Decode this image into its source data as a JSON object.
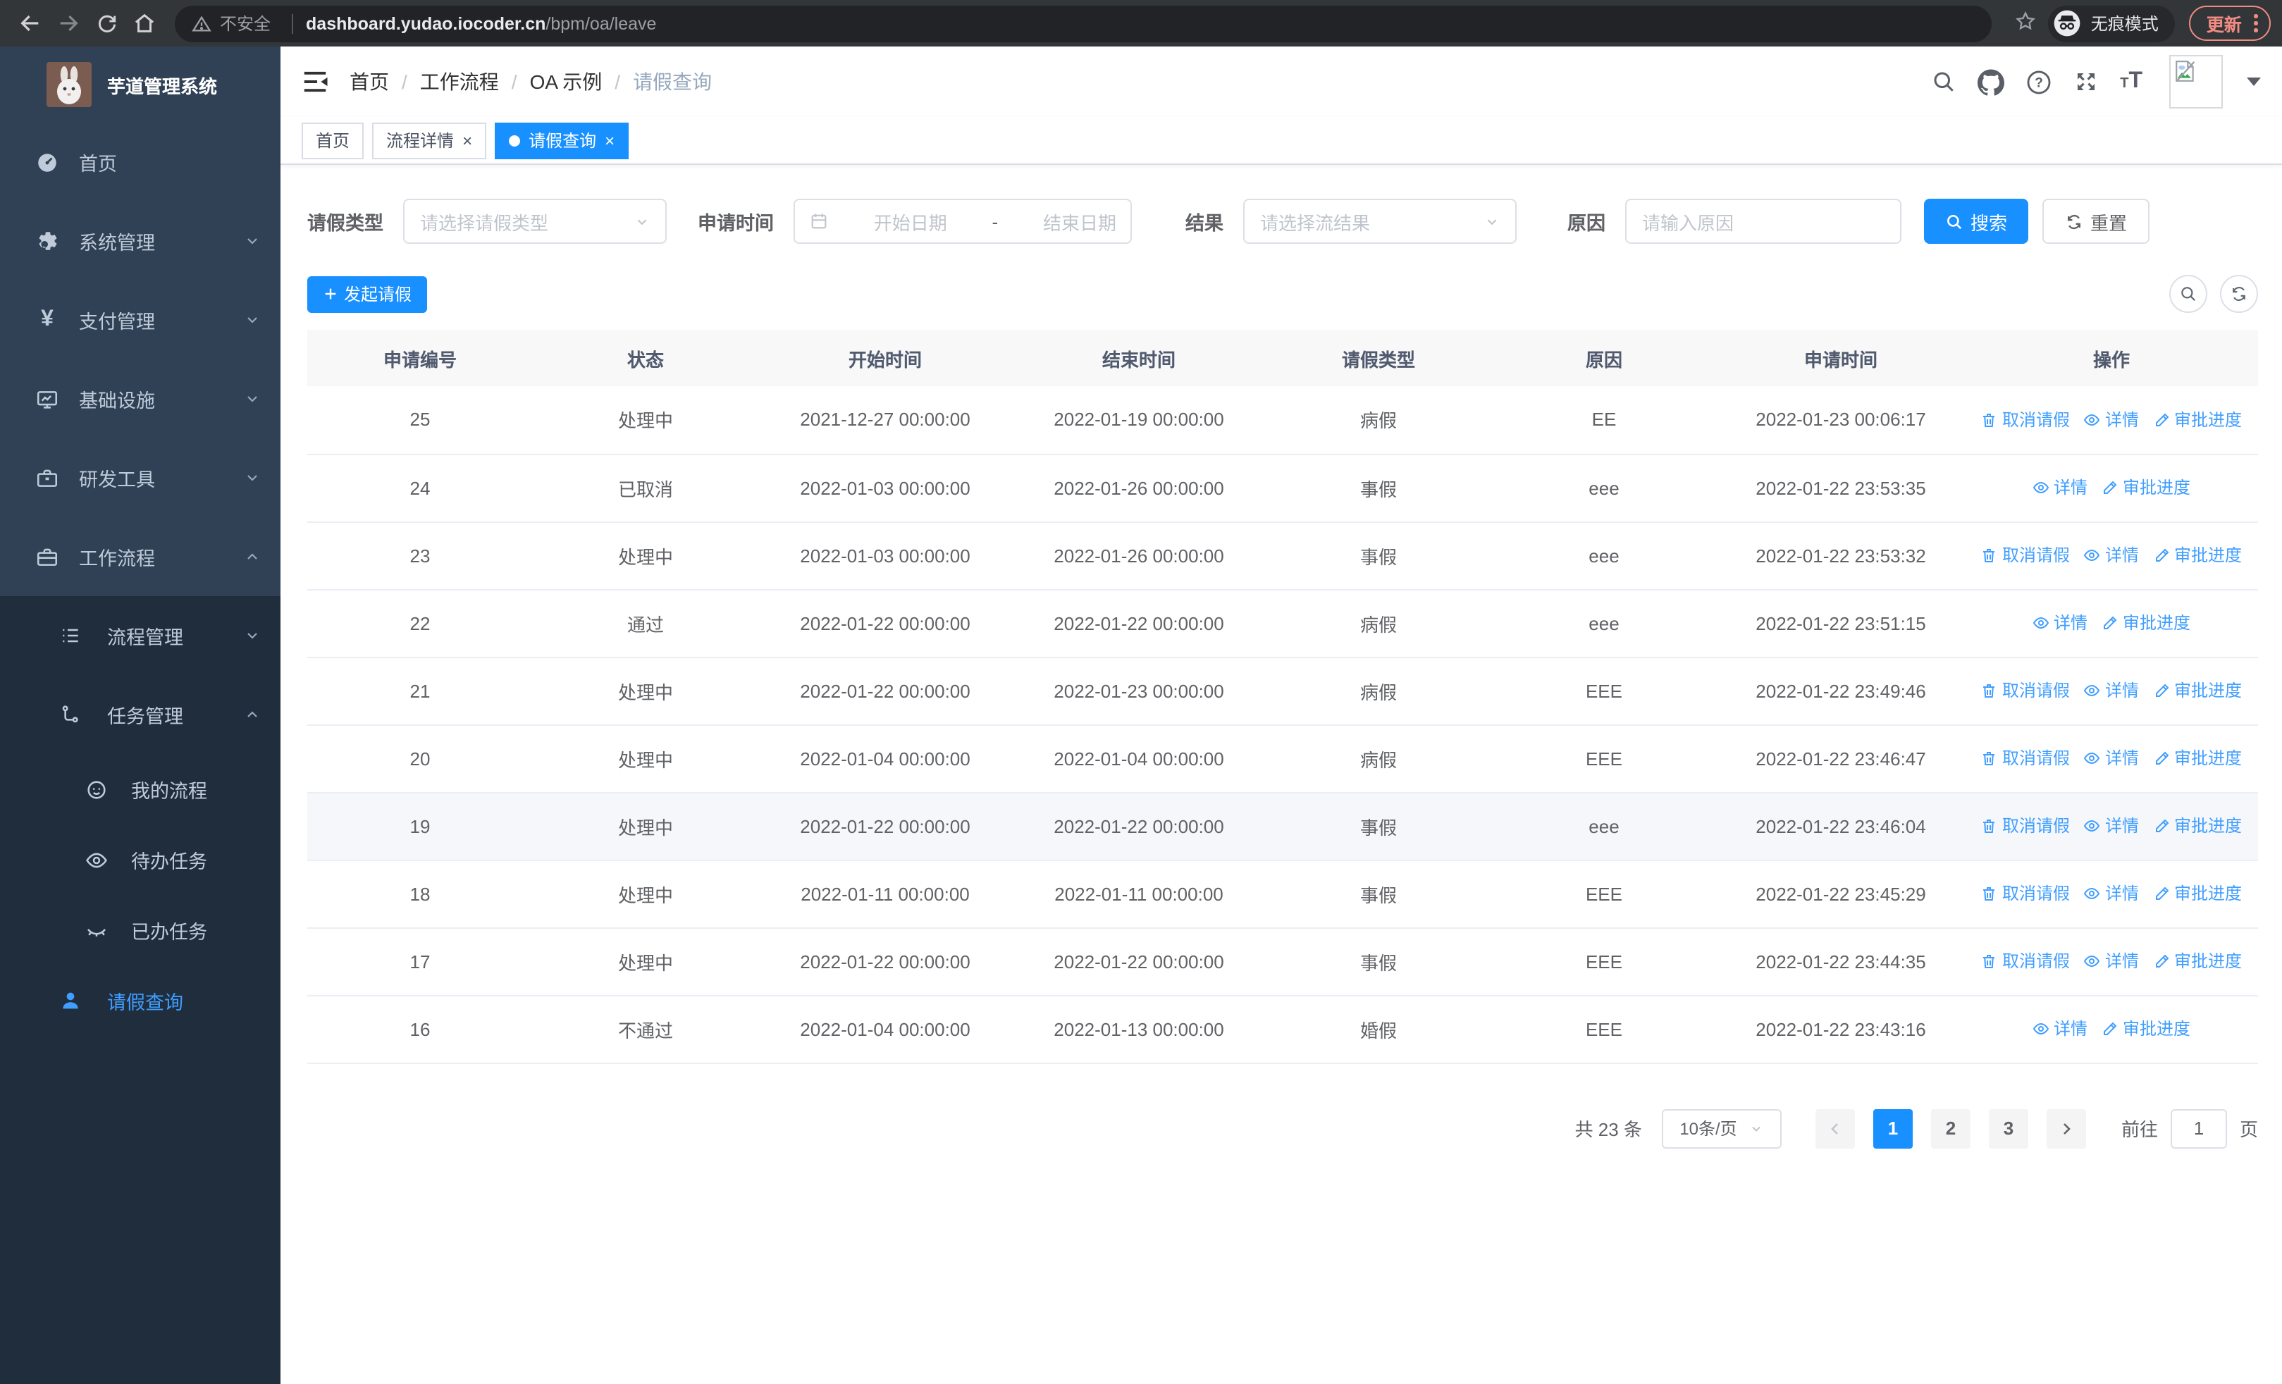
{
  "browser": {
    "security_label": "不安全",
    "url_host": "dashboard.yudao.iocoder.cn",
    "url_path": "/bpm/oa/leave",
    "incognito_label": "无痕模式",
    "update_label": "更新"
  },
  "sidebar": {
    "title": "芋道管理系统",
    "home": "首页",
    "system": "系统管理",
    "payment": "支付管理",
    "infra": "基础设施",
    "devtools": "研发工具",
    "workflow": "工作流程",
    "process_mgmt": "流程管理",
    "task_mgmt": "任务管理",
    "my_process": "我的流程",
    "todo_tasks": "待办任务",
    "done_tasks": "已办任务",
    "leave_query": "请假查询"
  },
  "navbar": {
    "breadcrumb": [
      "首页",
      "工作流程",
      "OA 示例",
      "请假查询"
    ]
  },
  "tabs": {
    "home": "首页",
    "process_detail": "流程详情",
    "leave_query": "请假查询"
  },
  "filters": {
    "leave_type_label": "请假类型",
    "leave_type_placeholder": "请选择请假类型",
    "apply_time_label": "申请时间",
    "start_placeholder": "开始日期",
    "separator": "-",
    "end_placeholder": "结束日期",
    "result_label": "结果",
    "result_placeholder": "请选择流结果",
    "reason_label": "原因",
    "reason_placeholder": "请输入原因",
    "search_label": "搜索",
    "reset_label": "重置"
  },
  "toolbar": {
    "create_label": "发起请假"
  },
  "table": {
    "columns": [
      "申请编号",
      "状态",
      "开始时间",
      "结束时间",
      "请假类型",
      "原因",
      "申请时间",
      "操作"
    ],
    "action_labels": {
      "cancel": "取消请假",
      "detail": "详情",
      "progress": "审批进度"
    },
    "rows": [
      {
        "id": "25",
        "status": "处理中",
        "start": "2021-12-27 00:00:00",
        "end": "2022-01-19 00:00:00",
        "type": "病假",
        "reason": "EE",
        "applied": "2022-01-23 00:06:17",
        "actions": [
          "cancel",
          "detail",
          "progress"
        ],
        "highlight": false
      },
      {
        "id": "24",
        "status": "已取消",
        "start": "2022-01-03 00:00:00",
        "end": "2022-01-26 00:00:00",
        "type": "事假",
        "reason": "eee",
        "applied": "2022-01-22 23:53:35",
        "actions": [
          "detail",
          "progress"
        ],
        "highlight": false
      },
      {
        "id": "23",
        "status": "处理中",
        "start": "2022-01-03 00:00:00",
        "end": "2022-01-26 00:00:00",
        "type": "事假",
        "reason": "eee",
        "applied": "2022-01-22 23:53:32",
        "actions": [
          "cancel",
          "detail",
          "progress"
        ],
        "highlight": false
      },
      {
        "id": "22",
        "status": "通过",
        "start": "2022-01-22 00:00:00",
        "end": "2022-01-22 00:00:00",
        "type": "病假",
        "reason": "eee",
        "applied": "2022-01-22 23:51:15",
        "actions": [
          "detail",
          "progress"
        ],
        "highlight": false
      },
      {
        "id": "21",
        "status": "处理中",
        "start": "2022-01-22 00:00:00",
        "end": "2022-01-23 00:00:00",
        "type": "病假",
        "reason": "EEE",
        "applied": "2022-01-22 23:49:46",
        "actions": [
          "cancel",
          "detail",
          "progress"
        ],
        "highlight": false
      },
      {
        "id": "20",
        "status": "处理中",
        "start": "2022-01-04 00:00:00",
        "end": "2022-01-04 00:00:00",
        "type": "病假",
        "reason": "EEE",
        "applied": "2022-01-22 23:46:47",
        "actions": [
          "cancel",
          "detail",
          "progress"
        ],
        "highlight": false
      },
      {
        "id": "19",
        "status": "处理中",
        "start": "2022-01-22 00:00:00",
        "end": "2022-01-22 00:00:00",
        "type": "事假",
        "reason": "eee",
        "applied": "2022-01-22 23:46:04",
        "actions": [
          "cancel",
          "detail",
          "progress"
        ],
        "highlight": true
      },
      {
        "id": "18",
        "status": "处理中",
        "start": "2022-01-11 00:00:00",
        "end": "2022-01-11 00:00:00",
        "type": "事假",
        "reason": "EEE",
        "applied": "2022-01-22 23:45:29",
        "actions": [
          "cancel",
          "detail",
          "progress"
        ],
        "highlight": false
      },
      {
        "id": "17",
        "status": "处理中",
        "start": "2022-01-22 00:00:00",
        "end": "2022-01-22 00:00:00",
        "type": "事假",
        "reason": "EEE",
        "applied": "2022-01-22 23:44:35",
        "actions": [
          "cancel",
          "detail",
          "progress"
        ],
        "highlight": false
      },
      {
        "id": "16",
        "status": "不通过",
        "start": "2022-01-04 00:00:00",
        "end": "2022-01-13 00:00:00",
        "type": "婚假",
        "reason": "EEE",
        "applied": "2022-01-22 23:43:16",
        "actions": [
          "detail",
          "progress"
        ],
        "highlight": false
      }
    ]
  },
  "pagination": {
    "total_label": "共 23 条",
    "page_size_label": "10条/页",
    "pages": [
      "1",
      "2",
      "3"
    ],
    "active_page": "1",
    "goto_label": "前往",
    "goto_value": "1",
    "goto_suffix": "页"
  },
  "colors": {
    "primary": "#1890ff",
    "link": "#409eff",
    "sidebar_bg": "#304156",
    "submenu_bg": "#1f2d3d",
    "sidebar_text": "#bfcbd9"
  }
}
